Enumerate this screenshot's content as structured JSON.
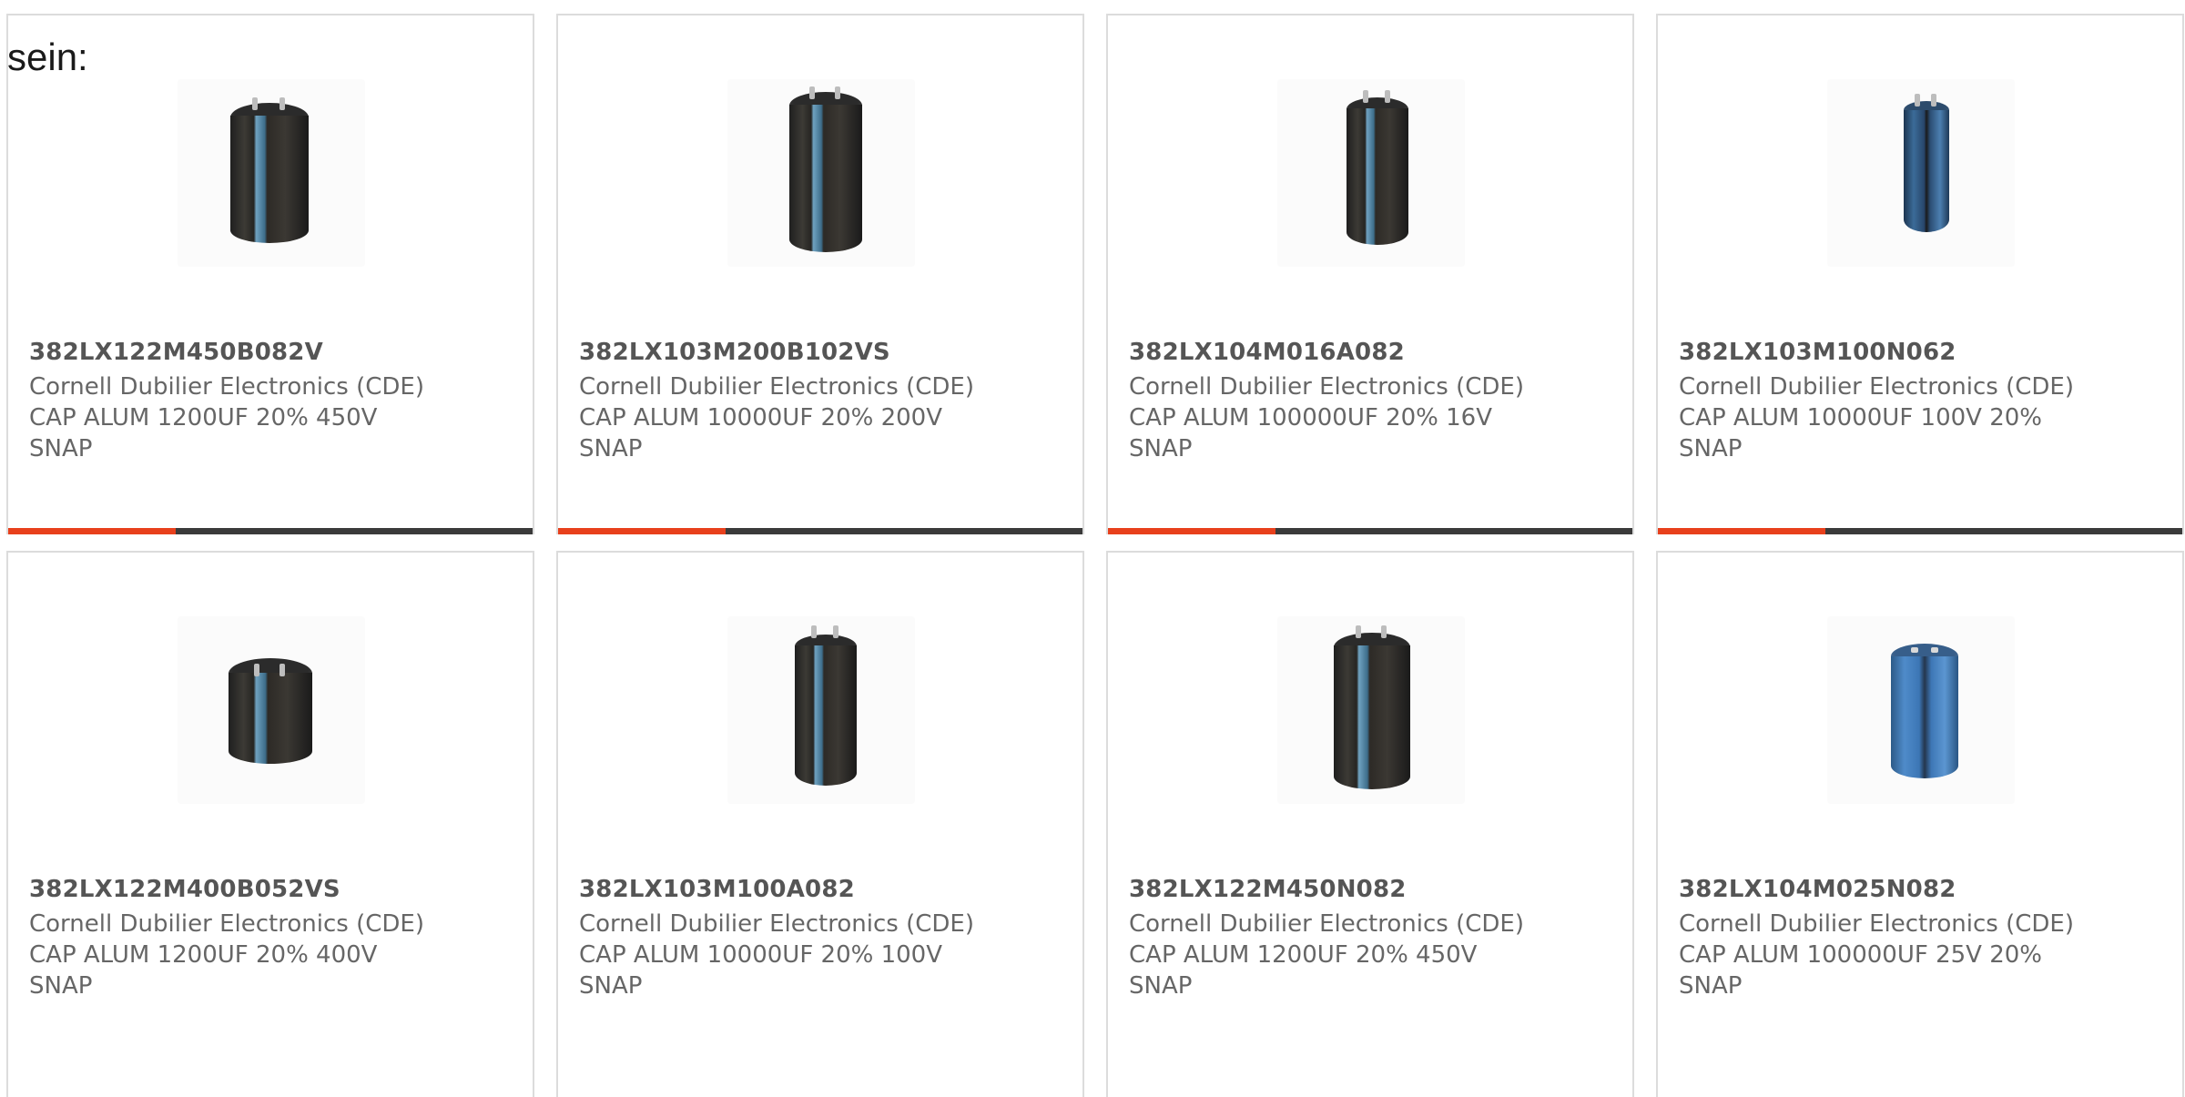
{
  "intro_text": "sein:",
  "colors": {
    "accent": "#e8401c",
    "bar_track": "#3a3a3a",
    "card_border": "#dcdcdc",
    "text": "#666666"
  },
  "products": [
    {
      "part": "382LX122M450B082V",
      "manufacturer": "Cornell Dubilier Electronics (CDE)",
      "desc_line1": "CAP ALUM 1200UF 20% 450V",
      "desc_line2": "SNAP",
      "image_icon": "capacitor-image",
      "progress": 0.32
    },
    {
      "part": "382LX103M200B102VS",
      "manufacturer": "Cornell Dubilier Electronics (CDE)",
      "desc_line1": "CAP ALUM 10000UF 20% 200V",
      "desc_line2": "SNAP",
      "image_icon": "capacitor-image",
      "progress": 0.32
    },
    {
      "part": "382LX104M016A082",
      "manufacturer": "Cornell Dubilier Electronics (CDE)",
      "desc_line1": "CAP ALUM 100000UF 20% 16V",
      "desc_line2": "SNAP",
      "image_icon": "capacitor-image",
      "progress": 0.32
    },
    {
      "part": "382LX103M100N062",
      "manufacturer": "Cornell Dubilier Electronics (CDE)",
      "desc_line1": "CAP ALUM 10000UF 100V 20%",
      "desc_line2": "SNAP",
      "image_icon": "capacitor-image",
      "progress": 0.32
    },
    {
      "part": "382LX122M400B052VS",
      "manufacturer": "Cornell Dubilier Electronics (CDE)",
      "desc_line1": "CAP ALUM 1200UF 20% 400V",
      "desc_line2": "SNAP",
      "image_icon": "capacitor-image"
    },
    {
      "part": "382LX103M100A082",
      "manufacturer": "Cornell Dubilier Electronics (CDE)",
      "desc_line1": "CAP ALUM 10000UF 20% 100V",
      "desc_line2": "SNAP",
      "image_icon": "capacitor-image"
    },
    {
      "part": "382LX122M450N082",
      "manufacturer": "Cornell Dubilier Electronics (CDE)",
      "desc_line1": "CAP ALUM 1200UF 20% 450V",
      "desc_line2": "SNAP",
      "image_icon": "capacitor-image"
    },
    {
      "part": "382LX104M025N082",
      "manufacturer": "Cornell Dubilier Electronics (CDE)",
      "desc_line1": "CAP ALUM 100000UF 25V 20%",
      "desc_line2": "SNAP",
      "image_icon": "capacitor-image"
    }
  ]
}
